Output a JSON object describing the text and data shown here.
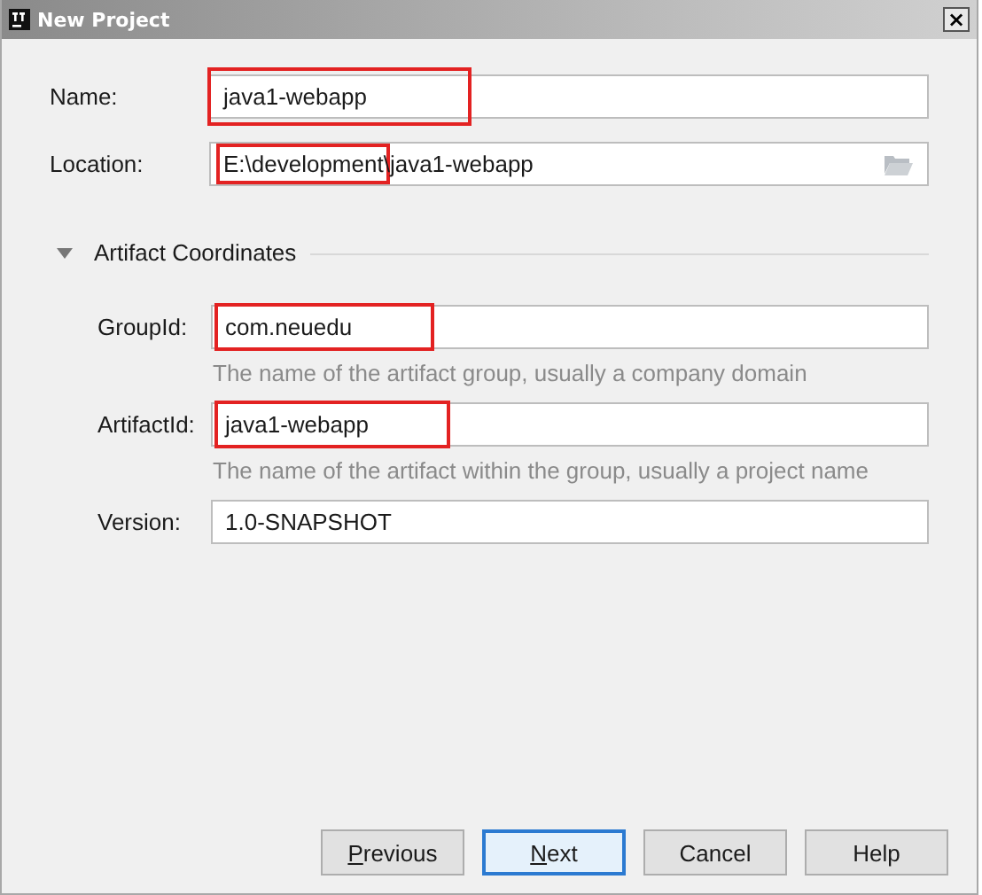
{
  "window": {
    "title": "New Project",
    "close": "×"
  },
  "name": {
    "label": "Name:",
    "value": [
      {
        "text": "java1-webapp",
        "highlighted": true
      }
    ]
  },
  "location": {
    "label": "Location:",
    "value": [
      {
        "text": "E:\\development",
        "highlighted": true
      },
      {
        "text": "\\java1-webapp",
        "highlighted": false
      }
    ]
  },
  "section": {
    "title": "Artifact Coordinates",
    "expanded": true
  },
  "coordinates": [
    {
      "label": "GroupId:",
      "value": [
        {
          "text": "com.neuedu",
          "highlighted": true
        }
      ],
      "hint": "The name of the artifact group, usually a company domain"
    },
    {
      "label": "ArtifactId:",
      "value": [
        {
          "text": "java1-webapp",
          "highlighted": true
        }
      ],
      "hint": "The name of the artifact within the group, usually a project name"
    },
    {
      "label": "Version:",
      "value": [
        {
          "text": "1.0-SNAPSHOT",
          "highlighted": false
        }
      ]
    }
  ],
  "buttons": [
    {
      "mnemonic": "P",
      "rest": "revious",
      "default": false
    },
    {
      "mnemonic": "N",
      "rest": "ext",
      "default": true
    },
    {
      "rest": "Cancel",
      "default": false
    },
    {
      "rest": "Help",
      "default": false
    }
  ]
}
